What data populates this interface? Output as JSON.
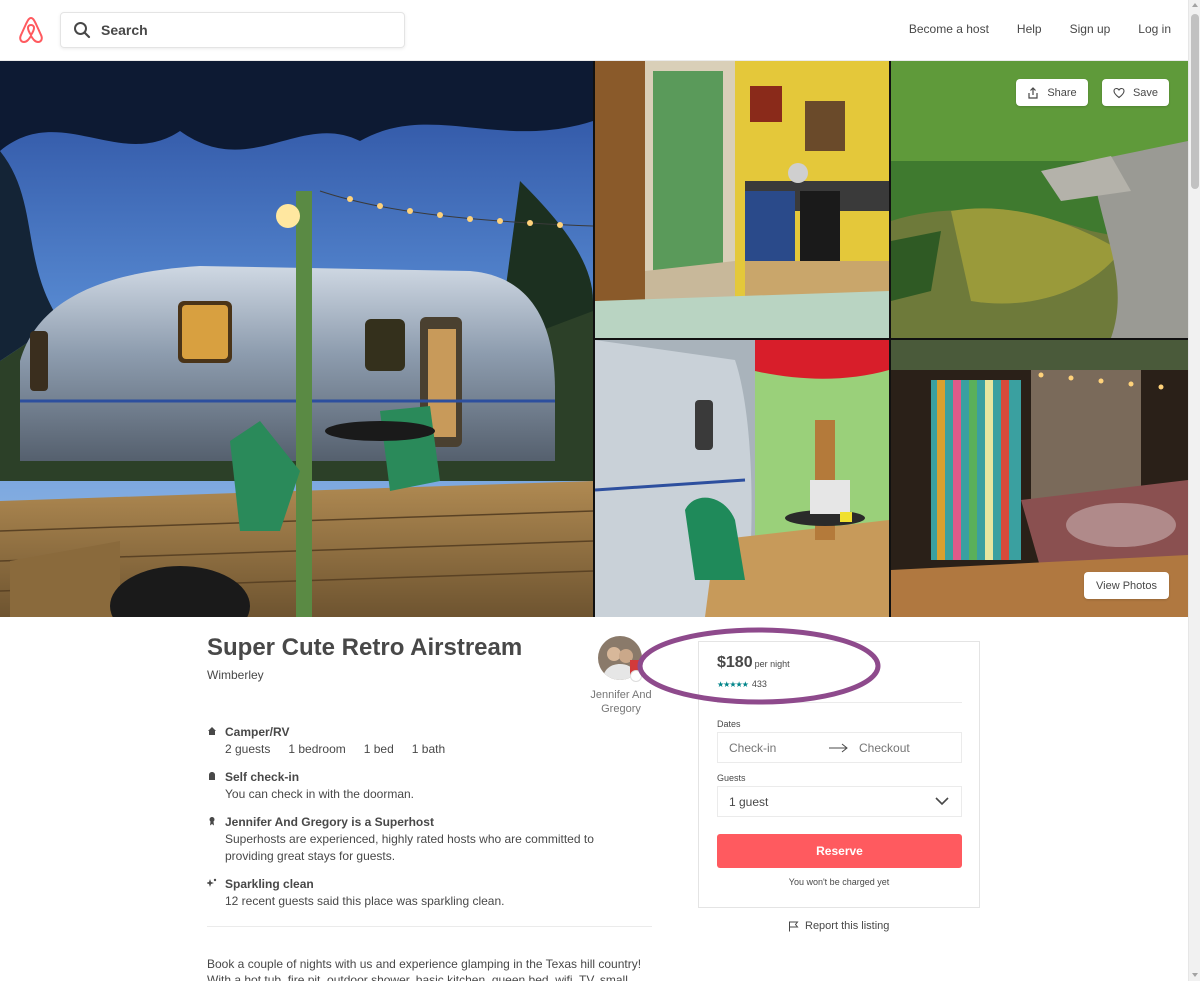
{
  "header": {
    "search_placeholder": "Search",
    "nav": [
      "Become a host",
      "Help",
      "Sign up",
      "Log in"
    ]
  },
  "photos": {
    "share_label": "Share",
    "save_label": "Save",
    "view_photos_label": "View Photos"
  },
  "listing": {
    "title": "Super Cute Retro Airstream",
    "location": "Wimberley",
    "host_name": "Jennifer And Gregory",
    "features": [
      {
        "icon": "home-icon",
        "title": "Camper/RV",
        "stats": [
          "2 guests",
          "1 bedroom",
          "1 bed",
          "1 bath"
        ]
      },
      {
        "icon": "key-icon",
        "title": "Self check-in",
        "body": "You can check in with the doorman."
      },
      {
        "icon": "medal-icon",
        "title": "Jennifer And Gregory is a Superhost",
        "body": "Superhosts are experienced, highly rated hosts who are committed to providing great stays for guests."
      },
      {
        "icon": "sparkle-icon",
        "title": "Sparkling clean",
        "body": "12 recent guests said this place was sparkling clean."
      }
    ],
    "description": "Book a couple of nights with us and experience glamping in the Texas hill country! With a hot tub, fire pit, outdoor shower, basic kitchen, queen bed, wifi, TV, small"
  },
  "booking": {
    "price": "$180",
    "per_night": "per night",
    "stars": "★★★★★",
    "rating_value": 5,
    "review_count": "433",
    "dates_label": "Dates",
    "checkin_placeholder": "Check-in",
    "checkout_placeholder": "Checkout",
    "guests_label": "Guests",
    "guests_value": "1 guest",
    "reserve_label": "Reserve",
    "no_charge_note": "You won't be charged yet",
    "report_label": "Report this listing"
  },
  "colors": {
    "brand": "#ff5a5f",
    "stars": "#008489",
    "annotation": "#8e4a8c",
    "text": "#484848"
  }
}
